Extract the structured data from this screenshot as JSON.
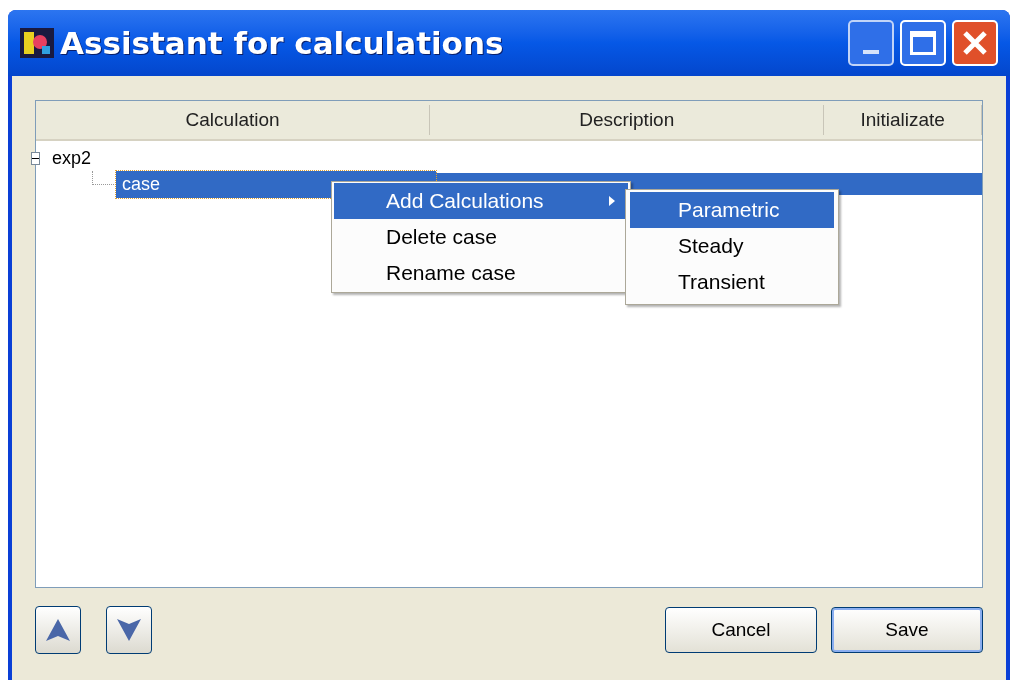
{
  "window": {
    "title": "Assistant for calculations"
  },
  "table": {
    "columns": [
      "Calculation",
      "Description",
      "Initializate"
    ],
    "tree": [
      {
        "label": "exp2",
        "expanded": true,
        "selected": false,
        "children": [
          {
            "label": "case",
            "selected": true
          }
        ]
      }
    ]
  },
  "context_menu": {
    "items": [
      {
        "label": "Add Calculations",
        "selected": true,
        "submenu": true
      },
      {
        "label": "Delete case",
        "selected": false,
        "submenu": false
      },
      {
        "label": "Rename case",
        "selected": false,
        "submenu": false
      }
    ]
  },
  "submenu": {
    "items": [
      {
        "label": "Parametric",
        "selected": true
      },
      {
        "label": "Steady",
        "selected": false
      },
      {
        "label": "Transient",
        "selected": false
      }
    ]
  },
  "buttons": [
    {
      "label": "Cancel",
      "default": false
    },
    {
      "label": "Save",
      "default": true
    }
  ]
}
